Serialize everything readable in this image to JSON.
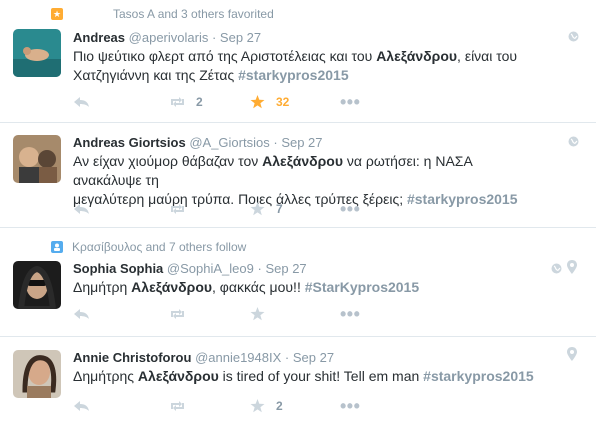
{
  "tweets": [
    {
      "context": "Tasos A and 3 others favorited",
      "fullname": "Andreas",
      "handle": "@aperivolaris",
      "dot": "·",
      "time": "Sep 27",
      "text_parts": [
        "Πιο ψεύτικο φλερτ από της Αριστοτέλειας και του ",
        "Αλεξάνδρου",
        ", είναι του\nΧατζηγιάννη και της Ζέτας ",
        "#starkypros2015"
      ],
      "retweets": "2",
      "favorites": "32"
    },
    {
      "fullname": "Andreas Giortsios",
      "handle": "@A_Giortsios",
      "dot": "·",
      "time": "Sep 27",
      "text_parts": [
        "Αν είχαν χιούμορ θάβαζαν τον ",
        "Αλεξάνδρου",
        " να ρωτήσει: η ΝΑΣΑ ανακάλυψε τη\nμεγαλύτερη μαύρη τρύπα. Ποιες άλλες τρύπες ξέρεις; ",
        "#starkypros2015"
      ],
      "retweets": "",
      "favorites": "7"
    },
    {
      "context": "Κρασίβουλος and 7 others follow",
      "fullname": "Sophia Sophia",
      "handle": "@SophiA_leo9",
      "dot": "·",
      "time": "Sep 27",
      "text_parts": [
        "Δημήτρη ",
        "Αλεξάνδρου",
        ", φακκάς μου!! ",
        "#StarKypros2015"
      ],
      "retweets": "",
      "favorites": ""
    },
    {
      "fullname": "Annie Christoforou",
      "handle": "@annie1948IX",
      "dot": "·",
      "time": "Sep 27",
      "text_parts": [
        "Δημήτρης ",
        "Αλεξάνδρου",
        " is tired of your shit! Tell em man ",
        "#starkypros2015"
      ],
      "retweets": "",
      "favorites": "2"
    }
  ],
  "colors": {
    "favorite_active": "#ffac33",
    "muted": "#8899a6",
    "text": "#292f33",
    "follow_badge": "#55acee"
  },
  "icons": {
    "reply": "reply-icon",
    "retweet": "retweet-icon",
    "favorite": "star-icon",
    "more": "more-icon",
    "globe": "globe-icon",
    "location": "location-pin-icon"
  }
}
